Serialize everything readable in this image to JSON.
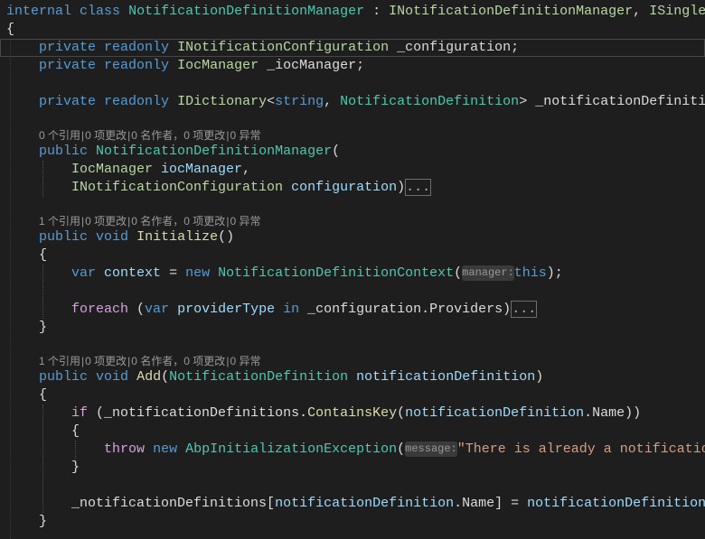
{
  "editor": {
    "theme": {
      "background": "#1e1e1e",
      "plain": "#dcdcdc",
      "keyword": "#569cd6",
      "control": "#d8a0df",
      "class": "#4ec9b0",
      "interface": "#b8d7a3",
      "method": "#dcdcaa",
      "variable": "#9cdcfe",
      "string": "#d69d85",
      "codelens": "#999999",
      "hint": "#9a9a9a",
      "hint_background": "#3a3a3a",
      "collapsed_text": "#b0b0b0",
      "collapsed_border": "#6e6e6e",
      "current_line_border": "#464646",
      "indent_guide": "#505050"
    },
    "codelens_separator": "|",
    "lines": [
      {
        "type": "code",
        "tokens": [
          [
            "keyword",
            "internal"
          ],
          [
            "plain",
            " "
          ],
          [
            "keyword",
            "class"
          ],
          [
            "plain",
            " "
          ],
          [
            "class",
            "NotificationDefinitionManager"
          ],
          [
            "plain",
            " : "
          ],
          [
            "interface",
            "INotificationDefinitionManager"
          ],
          [
            "plain",
            ", "
          ],
          [
            "interface",
            "ISingle"
          ]
        ]
      },
      {
        "type": "code",
        "tokens": [
          [
            "plain",
            "{"
          ]
        ]
      },
      {
        "type": "code",
        "current": true,
        "tokens": [
          [
            "plain",
            "    "
          ],
          [
            "keyword",
            "private"
          ],
          [
            "plain",
            " "
          ],
          [
            "keyword",
            "readonly"
          ],
          [
            "plain",
            " "
          ],
          [
            "interface",
            "INotificationConfiguration"
          ],
          [
            "plain",
            " _configuration;"
          ]
        ]
      },
      {
        "type": "code",
        "tokens": [
          [
            "plain",
            "    "
          ],
          [
            "keyword",
            "private"
          ],
          [
            "plain",
            " "
          ],
          [
            "keyword",
            "readonly"
          ],
          [
            "plain",
            " "
          ],
          [
            "interface",
            "IocManager"
          ],
          [
            "plain",
            " _iocManager;"
          ]
        ]
      },
      {
        "type": "code",
        "tokens": []
      },
      {
        "type": "code",
        "tokens": [
          [
            "plain",
            "    "
          ],
          [
            "keyword",
            "private"
          ],
          [
            "plain",
            " "
          ],
          [
            "keyword",
            "readonly"
          ],
          [
            "plain",
            " "
          ],
          [
            "interface",
            "IDictionary"
          ],
          [
            "plain",
            "<"
          ],
          [
            "keyword",
            "string"
          ],
          [
            "plain",
            ", "
          ],
          [
            "class",
            "NotificationDefinition"
          ],
          [
            "plain",
            "> _notificationDefiniti"
          ]
        ]
      },
      {
        "type": "code",
        "tokens": []
      },
      {
        "type": "codelens",
        "items": [
          "0 个引用",
          "0 项更改",
          "0 名作者，0 项更改",
          "0 异常"
        ]
      },
      {
        "type": "code",
        "tokens": [
          [
            "plain",
            "    "
          ],
          [
            "keyword",
            "public"
          ],
          [
            "plain",
            " "
          ],
          [
            "class",
            "NotificationDefinitionManager"
          ],
          [
            "plain",
            "("
          ]
        ]
      },
      {
        "type": "code",
        "tokens": [
          [
            "plain",
            "        "
          ],
          [
            "interface",
            "IocManager"
          ],
          [
            "plain",
            " "
          ],
          [
            "variable",
            "iocManager"
          ],
          [
            "plain",
            ","
          ]
        ]
      },
      {
        "type": "code",
        "tokens": [
          [
            "plain",
            "        "
          ],
          [
            "interface",
            "INotificationConfiguration"
          ],
          [
            "plain",
            " "
          ],
          [
            "variable",
            "configuration"
          ],
          [
            "plain",
            ")"
          ],
          [
            "collapsed",
            "..."
          ]
        ]
      },
      {
        "type": "code",
        "tokens": []
      },
      {
        "type": "codelens",
        "items": [
          "1 个引用",
          "0 项更改",
          "0 名作者，0 项更改",
          "0 异常"
        ]
      },
      {
        "type": "code",
        "tokens": [
          [
            "plain",
            "    "
          ],
          [
            "keyword",
            "public"
          ],
          [
            "plain",
            " "
          ],
          [
            "keyword",
            "void"
          ],
          [
            "plain",
            " "
          ],
          [
            "method",
            "Initialize"
          ],
          [
            "plain",
            "()"
          ]
        ]
      },
      {
        "type": "code",
        "tokens": [
          [
            "plain",
            "    {"
          ]
        ]
      },
      {
        "type": "code",
        "tokens": [
          [
            "plain",
            "        "
          ],
          [
            "keyword",
            "var"
          ],
          [
            "plain",
            " "
          ],
          [
            "variable",
            "context"
          ],
          [
            "plain",
            " = "
          ],
          [
            "keyword",
            "new"
          ],
          [
            "plain",
            " "
          ],
          [
            "class",
            "NotificationDefinitionContext"
          ],
          [
            "plain",
            "("
          ],
          [
            "hint",
            "manager:"
          ],
          [
            "keyword",
            "this"
          ],
          [
            "plain",
            ");"
          ]
        ]
      },
      {
        "type": "code",
        "tokens": []
      },
      {
        "type": "code",
        "tokens": [
          [
            "plain",
            "        "
          ],
          [
            "control",
            "foreach"
          ],
          [
            "plain",
            " ("
          ],
          [
            "keyword",
            "var"
          ],
          [
            "plain",
            " "
          ],
          [
            "variable",
            "providerType"
          ],
          [
            "plain",
            " "
          ],
          [
            "keyword",
            "in"
          ],
          [
            "plain",
            " _configuration.Providers)"
          ],
          [
            "collapsed",
            "..."
          ]
        ]
      },
      {
        "type": "code",
        "tokens": [
          [
            "plain",
            "    }"
          ]
        ]
      },
      {
        "type": "code",
        "tokens": []
      },
      {
        "type": "codelens",
        "items": [
          "1 个引用",
          "0 项更改",
          "0 名作者，0 项更改",
          "0 异常"
        ]
      },
      {
        "type": "code",
        "tokens": [
          [
            "plain",
            "    "
          ],
          [
            "keyword",
            "public"
          ],
          [
            "plain",
            " "
          ],
          [
            "keyword",
            "void"
          ],
          [
            "plain",
            " "
          ],
          [
            "method",
            "Add"
          ],
          [
            "plain",
            "("
          ],
          [
            "class",
            "NotificationDefinition"
          ],
          [
            "plain",
            " "
          ],
          [
            "variable",
            "notificationDefinition"
          ],
          [
            "plain",
            ")"
          ]
        ]
      },
      {
        "type": "code",
        "tokens": [
          [
            "plain",
            "    {"
          ]
        ]
      },
      {
        "type": "code",
        "tokens": [
          [
            "plain",
            "        "
          ],
          [
            "control",
            "if"
          ],
          [
            "plain",
            " (_notificationDefinitions."
          ],
          [
            "method",
            "ContainsKey"
          ],
          [
            "plain",
            "("
          ],
          [
            "variable",
            "notificationDefinition"
          ],
          [
            "plain",
            ".Name))"
          ]
        ]
      },
      {
        "type": "code",
        "tokens": [
          [
            "plain",
            "        {"
          ]
        ]
      },
      {
        "type": "code",
        "tokens": [
          [
            "plain",
            "            "
          ],
          [
            "control",
            "throw"
          ],
          [
            "plain",
            " "
          ],
          [
            "keyword",
            "new"
          ],
          [
            "plain",
            " "
          ],
          [
            "class",
            "AbpInitializationException"
          ],
          [
            "plain",
            "("
          ],
          [
            "hint",
            "message:"
          ],
          [
            "string",
            "\"There is already a notificatio"
          ]
        ]
      },
      {
        "type": "code",
        "tokens": [
          [
            "plain",
            "        }"
          ]
        ]
      },
      {
        "type": "code",
        "tokens": []
      },
      {
        "type": "code",
        "tokens": [
          [
            "plain",
            "        _notificationDefinitions["
          ],
          [
            "variable",
            "notificationDefinition"
          ],
          [
            "plain",
            ".Name] = "
          ],
          [
            "variable",
            "notificationDefinition"
          ]
        ]
      },
      {
        "type": "code",
        "tokens": [
          [
            "plain",
            "    }"
          ]
        ]
      }
    ]
  }
}
